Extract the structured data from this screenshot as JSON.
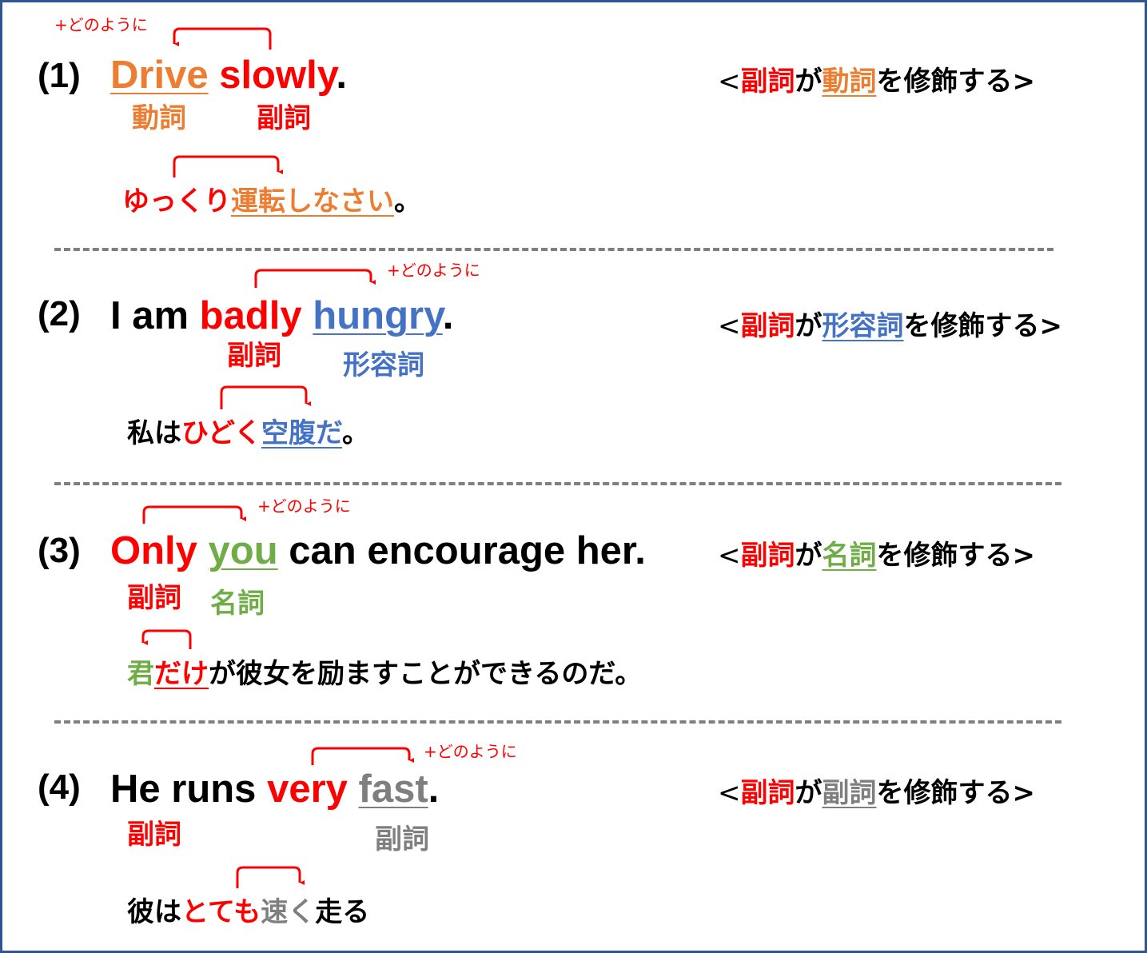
{
  "colors": {
    "verb": "#ED7D31",
    "adverb": "#FF0000",
    "adjective": "#4472C4",
    "noun": "#70AD47",
    "adverb_modified": "#7F7F7F",
    "border": "#2F5597",
    "divider": "#7F7F7F"
  },
  "sections": [
    {
      "number": "(1)",
      "annotation": "+どのように",
      "sentence": [
        "Drive",
        " slowly",
        "."
      ],
      "labels": [
        "動詞",
        "副詞"
      ],
      "translation": [
        "ゆっくり",
        "運転しなさい",
        "。"
      ],
      "rule": [
        "<",
        "副詞",
        "が",
        "動詞",
        "を修飾する>"
      ]
    },
    {
      "number": "(2)",
      "annotation": "+どのように",
      "sentence": [
        "I am ",
        "badly",
        " ",
        "hungry",
        "."
      ],
      "labels": [
        "副詞",
        "形容詞"
      ],
      "translation": [
        "私は",
        "ひどく",
        "空腹だ",
        "。"
      ],
      "rule": [
        "<",
        "副詞",
        "が",
        "形容詞",
        "を修飾する>"
      ]
    },
    {
      "number": "(3)",
      "annotation": "+どのように",
      "sentence": [
        "Only",
        " ",
        "you",
        " can encourage her."
      ],
      "labels": [
        "副詞",
        "名詞"
      ],
      "translation": [
        "君",
        "だけ",
        "が彼女を励ますことができるのだ。"
      ],
      "rule": [
        "<",
        "副詞",
        "が",
        "名詞",
        "を修飾する>"
      ]
    },
    {
      "number": "(4)",
      "annotation": "+どのように",
      "sentence": [
        "He runs ",
        "very",
        " ",
        "fast",
        "."
      ],
      "labels": [
        "副詞",
        "副詞"
      ],
      "translation": [
        "彼は",
        "とても",
        "速く",
        "走る"
      ],
      "rule": [
        "<",
        "副詞",
        "が",
        "副詞",
        "を修飾する>"
      ]
    }
  ]
}
